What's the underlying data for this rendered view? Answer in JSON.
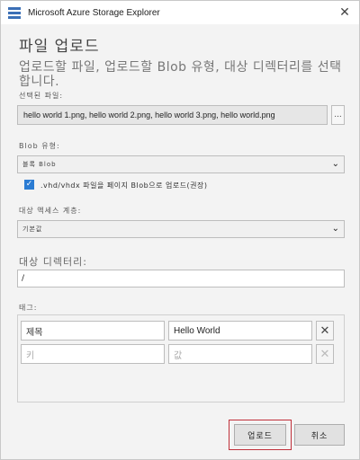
{
  "window": {
    "title": "Microsoft Azure Storage Explorer",
    "close_glyph": "✕"
  },
  "dialog": {
    "title": "파일 업로드",
    "description": "업로드할 파일, 업로드할 Blob 유형, 대상 디렉터리를 선택합니다."
  },
  "selected_files": {
    "label": "선택된 파일:",
    "value": "hello world 1.png, hello world 2.png, hello world 3.png, hello world.png",
    "browse_label": "..."
  },
  "blob_type": {
    "label": "Blob 유형:",
    "value": "블록 Blob"
  },
  "vhd_checkbox": {
    "checked": true,
    "label": ".vhd/vhdx 파일을 페이지 Blob으로 업로드(권장)"
  },
  "access_tier": {
    "label": "대상 액세스 계층:",
    "value": "기본값"
  },
  "destination": {
    "label": "대상 디렉터리:",
    "value": "/"
  },
  "tags": {
    "label": "태그:",
    "rows": [
      {
        "key": "제목",
        "key_placeholder": false,
        "value": "Hello World",
        "value_placeholder": false,
        "delete_enabled": true
      },
      {
        "key": "키",
        "key_placeholder": true,
        "value": "값",
        "value_placeholder": true,
        "delete_enabled": false
      }
    ],
    "delete_glyph": "✕"
  },
  "buttons": {
    "upload": "업로드",
    "cancel": "취소"
  },
  "colors": {
    "accent": "#2b7cd3",
    "highlight": "#c0303a"
  }
}
